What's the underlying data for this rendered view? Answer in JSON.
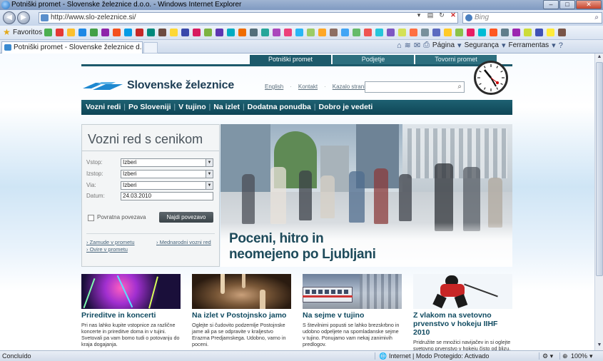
{
  "browser": {
    "title": "Potniški promet - Slovenske železnice d.o.o. - Windows Internet Explorer",
    "url": "http://www.slo-zeleznice.si/",
    "search_placeholder": "Bing",
    "favorites_label": "Favoritos",
    "tab_title": "Potniški promet - Slovenske železnice d.o.o.",
    "commands": {
      "page": "Página",
      "security": "Segurança",
      "tools": "Ferramentas"
    },
    "window_buttons": {
      "minimize": "–",
      "maximize": "□",
      "close": "✕"
    }
  },
  "site": {
    "top_tabs": [
      "Potniški promet",
      "Podjetje",
      "Tovorni promet"
    ],
    "logo_text": "Slovenske železnice",
    "utility_links": [
      "English",
      "Kontakt",
      "Kazalo strani"
    ],
    "main_nav": [
      "Vozni redi",
      "Po Sloveniji",
      "V tujino",
      "Na izlet",
      "Dodatna ponudba",
      "Dobro je vedeti"
    ],
    "timetable": {
      "title": "Vozni red s cenikom",
      "fields": [
        {
          "label": "Vstop:",
          "value": "Izberi"
        },
        {
          "label": "Izstop:",
          "value": "Izberi"
        },
        {
          "label": "Via:",
          "value": "Izberi"
        }
      ],
      "date_label": "Datum:",
      "date_value": "24.03.2010",
      "return_label": "Povratna povezava",
      "submit_label": "Najdi povezavo",
      "links": [
        "Zamude v prometu",
        "Mednarodni vozni red",
        "Ovire v prometu"
      ]
    },
    "hero": {
      "caption_line1": "Poceni, hitro in",
      "caption_line2": "neomejeno po Ljubljani"
    },
    "teasers": [
      {
        "title": "Prireditve in koncerti",
        "text": "Pri nas lahko kupite vstopnice za različne koncerte in prireditve doma in v tujini. Svetovali pa vam bomo tudi o potovanju do kraja dogajanja."
      },
      {
        "title": "Na izlet v Postojnsko jamo",
        "text": "Oglejte si čudovito podzemlje Postojnske jame ali pa se odpravite v kraljestvo Erazma Predjamskega. Udobno, varno in poceni."
      },
      {
        "title": "Na sejme v tujino",
        "text": "S številnimi popusti se lahko brezskrbno in udobno odpeljete na spomladanske sejme v tujino. Ponujamo vam nekaj zanimivih predlogov."
      },
      {
        "title": "Z vlakom na svetovno prvenstvo v hokeju IIHF 2010",
        "text": "Pridružite se množici navijačev in si oglejte svetovno prvenstvo v hokeju čisto od blizu. Naj se vaše brezskrbne priprave na tekmo"
      }
    ]
  },
  "statusbar": {
    "left": "Concluído",
    "zone": "Internet | Modo Protegido: Activado",
    "zoom": "100%"
  },
  "colors": {
    "brand_teal": "#1d5a6b",
    "brand_blue": "#1e88d0",
    "title_text": "#0f4a60"
  }
}
